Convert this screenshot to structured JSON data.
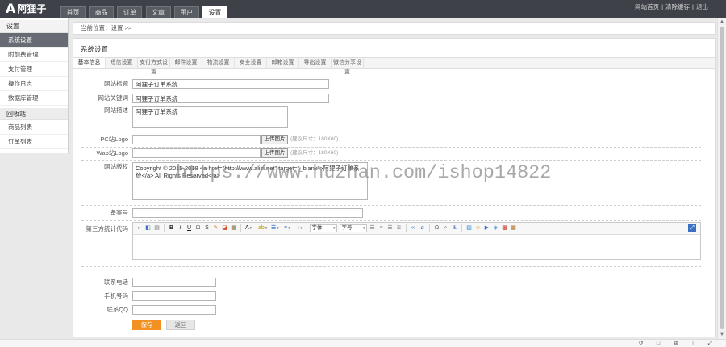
{
  "app": {
    "logo_text": "阿狸子"
  },
  "topnav": {
    "tabs": [
      {
        "label": "首页"
      },
      {
        "label": "商品"
      },
      {
        "label": "订单"
      },
      {
        "label": "文章"
      },
      {
        "label": "用户"
      },
      {
        "label": "设置",
        "active": true
      }
    ],
    "links": [
      "网站首页",
      "清除缓存",
      "退出"
    ],
    "separator": "|"
  },
  "sidebar": {
    "groups": [
      {
        "title": "设置",
        "items": [
          "系统设置",
          "附加费管理",
          "支付管理",
          "操作日志",
          "数据库管理"
        ]
      },
      {
        "title": "回收站",
        "items": [
          "商品列表",
          "订单列表"
        ]
      }
    ],
    "active_item": "系统设置"
  },
  "breadcrumb": {
    "text": "当前位置：设置 >>"
  },
  "panel": {
    "title": "系统设置",
    "tabs": [
      "基本信息",
      "短信设置",
      "支付方式设置",
      "邮件设置",
      "物流设置",
      "安全设置",
      "邮箱设置",
      "导出设置",
      "微信分享设置"
    ],
    "active_tab": "基本信息"
  },
  "form": {
    "site_title": {
      "label": "网站标题",
      "value": "阿狸子订单系统"
    },
    "keywords": {
      "label": "网站关键词",
      "value": "阿狸子订单系统"
    },
    "description": {
      "label": "网站描述",
      "value": "阿狸子订单系统"
    },
    "pc_logo": {
      "label": "PC站Logo",
      "value": "",
      "button": "上传图片",
      "hint": "(建议尺寸：180X60)"
    },
    "wap_logo": {
      "label": "Wap站Logo",
      "value": "",
      "button": "上传图片",
      "hint": "(建议尺寸：180X60)"
    },
    "copyright": {
      "label": "网站版权",
      "value": "Copyright © 2015-2018 <a href=\"http://www.alizi.net\" target=\"_blank\">阿狸子订单系统</a> All Rights Reserved</a>"
    },
    "icp": {
      "label": "备案号",
      "value": ""
    },
    "third_party_code": {
      "label": "第三方统计代码",
      "editor": {
        "font_family_label": "字体",
        "font_size_label": "字号",
        "toolbar": [
          {
            "name": "source-icon"
          },
          {
            "name": "preview-icon"
          },
          {
            "name": "template-icon"
          },
          {
            "type": "sep"
          },
          {
            "name": "bold-icon"
          },
          {
            "name": "italic-icon"
          },
          {
            "name": "underline-icon"
          },
          {
            "name": "border-icon"
          },
          {
            "name": "strikethrough-icon"
          },
          {
            "name": "format-painter-icon"
          },
          {
            "name": "eraser-icon"
          },
          {
            "name": "paste-text-icon"
          },
          {
            "type": "sep"
          },
          {
            "name": "font-color-icon",
            "dropdown": true
          },
          {
            "name": "highlight-icon",
            "dropdown": true
          },
          {
            "name": "unordered-list-icon",
            "dropdown": true
          },
          {
            "name": "ordered-list-icon",
            "dropdown": true
          },
          {
            "name": "line-height-icon",
            "dropdown": true
          },
          {
            "name": "font-family-select",
            "select": "font_family_label"
          },
          {
            "name": "font-size-select",
            "select": "font_size_label"
          },
          {
            "name": "align-left-icon"
          },
          {
            "name": "align-center-icon"
          },
          {
            "name": "align-right-icon"
          },
          {
            "name": "align-justify-icon"
          },
          {
            "type": "sep"
          },
          {
            "name": "link-icon"
          },
          {
            "name": "unlink-icon"
          },
          {
            "type": "sep"
          },
          {
            "name": "special-char-icon"
          },
          {
            "name": "search-icon"
          },
          {
            "name": "anchor-icon"
          },
          {
            "type": "sep"
          },
          {
            "name": "image-icon"
          },
          {
            "name": "emoticon-icon"
          },
          {
            "name": "video-icon"
          },
          {
            "name": "map-icon"
          },
          {
            "name": "attachment-icon"
          },
          {
            "name": "table-icon"
          }
        ],
        "toolbar_right": "fullscreen-icon",
        "content": ""
      }
    },
    "phone": {
      "label": "联系电话",
      "value": ""
    },
    "mobile": {
      "label": "手机号码",
      "value": ""
    },
    "qq": {
      "label": "联系QQ",
      "value": ""
    },
    "save_button": "保存",
    "back_button": "返回"
  },
  "watermark": "https://www.huzhan.com/ishop14822",
  "scrollbar": {
    "up_icon": "scroll-up-icon",
    "down_icon": "scroll-down-icon"
  },
  "statusbar": {
    "icons": [
      "refresh-icon",
      "stop-icon",
      "copy-icon",
      "split-view-icon",
      "expand-icon"
    ]
  },
  "colors": {
    "topbar": "#3e4148",
    "active_sidebar": "#676c74",
    "save_button": "#f39022",
    "watermark": "#8c8c8c"
  }
}
